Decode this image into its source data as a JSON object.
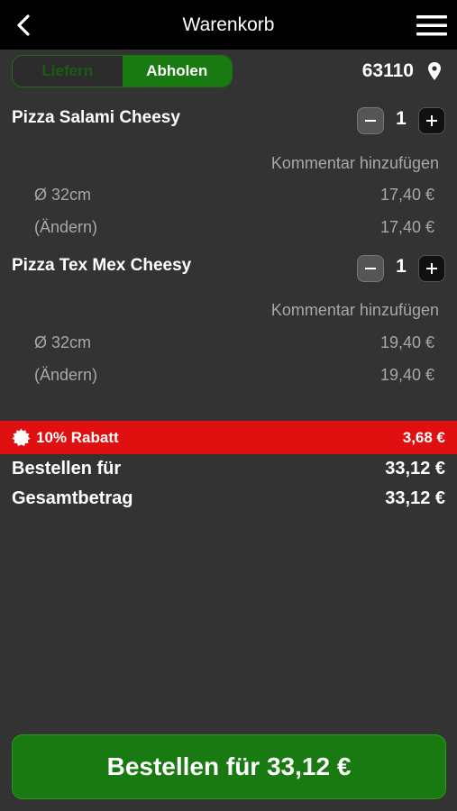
{
  "header": {
    "title": "Warenkorb",
    "back_icon": "chevron-left-icon",
    "menu_icon": "hamburger-menu-icon"
  },
  "mode": {
    "deliver_label": "Liefern",
    "pickup_label": "Abholen",
    "selected": "pickup"
  },
  "location": {
    "zip": "63110",
    "icon": "map-pin-icon"
  },
  "items": [
    {
      "name": "Pizza Salami Cheesy",
      "quantity": "1",
      "comment_label": "Kommentar hinzufügen",
      "lines": [
        {
          "label": "Ø 32cm",
          "price": "17,40 €"
        },
        {
          "label": "(Ändern)",
          "price": "17,40 €"
        }
      ]
    },
    {
      "name": "Pizza Tex Mex Cheesy",
      "quantity": "1",
      "comment_label": "Kommentar hinzufügen",
      "lines": [
        {
          "label": "Ø 32cm",
          "price": "19,40 €"
        },
        {
          "label": "(Ändern)",
          "price": "19,40 €"
        }
      ]
    }
  ],
  "discount": {
    "label": "10% Rabatt",
    "amount": "3,68 €",
    "color": "#e01010"
  },
  "totals": {
    "order_for_label": "Bestellen für",
    "order_for_value": "33,12 €",
    "total_label": "Gesamtbetrag",
    "total_value": "33,12 €"
  },
  "checkout": {
    "button_label": "Bestellen für 33,12 €",
    "color": "#1a7a12"
  }
}
